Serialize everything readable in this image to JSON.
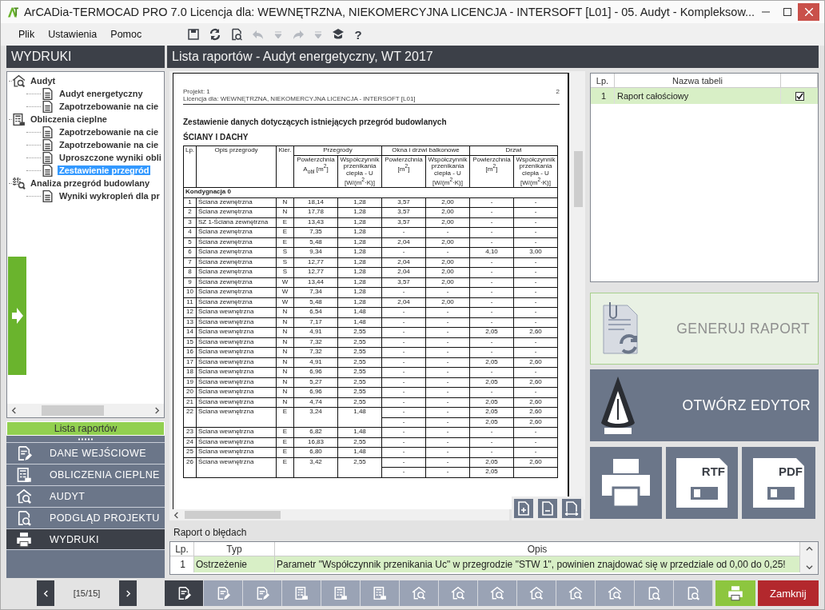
{
  "window": {
    "title": "ArCADia-TERMOCAD PRO 7.0 Licencja dla: WEWNĘTRZNA, NIEKOMERCYJNA LICENCJA - INTERSOFT [L01] - 05. Audyt - Kompleksow..."
  },
  "menu": [
    {
      "label": "Plik"
    },
    {
      "label": "Ustawienia"
    },
    {
      "label": "Pomoc"
    }
  ],
  "toolbar": [
    {
      "kind": "save",
      "disabled": false
    },
    {
      "kind": "refresh",
      "disabled": false
    },
    {
      "kind": "preview",
      "disabled": false
    },
    {
      "kind": "undo",
      "disabled": true
    },
    {
      "kind": "dropdown",
      "disabled": true
    },
    {
      "kind": "redo",
      "disabled": true
    },
    {
      "kind": "dropdown",
      "disabled": true
    },
    {
      "kind": "layers",
      "disabled": false
    },
    {
      "kind": "help",
      "label": "?",
      "disabled": false
    }
  ],
  "sidebar": {
    "title": "WYDRUKI",
    "tree": [
      {
        "label": "Audyt",
        "kind": "audit",
        "selected": false,
        "children": [
          {
            "label": "Audyt energetyczny",
            "kind": "doc",
            "selected": false
          },
          {
            "label": "Zapotrzebowanie na cie",
            "kind": "doc",
            "selected": false
          }
        ]
      },
      {
        "label": "Obliczenia cieplne",
        "kind": "calc",
        "selected": false,
        "children": [
          {
            "label": "Zapotrzebowanie na cie",
            "kind": "doc",
            "selected": false
          },
          {
            "label": "Zapotrzebowanie na cie",
            "kind": "doc",
            "selected": false
          },
          {
            "label": "Uproszczone wyniki obli",
            "kind": "doc",
            "selected": false
          },
          {
            "label": "Zestawienie przegród",
            "kind": "doc",
            "selected": true
          }
        ]
      },
      {
        "label": "Analiza przegród budowlany",
        "kind": "analysis",
        "selected": false,
        "children": [
          {
            "label": "Wyniki wykropleń dla pr",
            "kind": "doc",
            "selected": false
          }
        ]
      }
    ],
    "panel_tab": "Lista raportów",
    "nav": [
      {
        "label": "DANE WEJŚCIOWE",
        "kind": "input",
        "selected": false
      },
      {
        "label": "OBLICZENIA CIEPLNE",
        "kind": "calc",
        "selected": false
      },
      {
        "label": "AUDYT",
        "kind": "audit",
        "selected": false
      },
      {
        "label": "PODGLĄD PROJEKTU",
        "kind": "preview",
        "selected": false
      },
      {
        "label": "WYDRUKI",
        "kind": "print",
        "selected": true
      }
    ],
    "pager": "[15/15]"
  },
  "main": {
    "title": "Lista raportów - Audyt energetyczny, WT 2017",
    "document": {
      "project": "Projekt: 1",
      "license": "Licencja dla: WEWNĘTRZNA, NIEKOMERCYJNA LICENCJA - INTERSOFT [L01]",
      "page": "2",
      "title": "Zestawienie danych dotyczących istniejących przegród budowlanych",
      "subtitle": "ŚCIANY I DACHY",
      "columns": [
        "Lp.",
        "Opis przegrody",
        "Kier."
      ],
      "groups": [
        "Przegrody",
        "Okna i drzwi balkonowe",
        "Drzwi"
      ],
      "subcolumns": [
        "Powierzchnia A$_{obl}$ [m$^{2}$]",
        "Współczynnik przenikania ciepła - U [W/(m$^{2}$·K)]",
        "Powierzchnia [m$^{2}$]",
        "Współczynnik przenikania ciepła - U [W/(m$^{2}$·K)]",
        "Powierzchnia [m$^{2}$]",
        "Współczynnik przenikania ciepła - U [W/(m$^{2}$·K)]"
      ],
      "section": "Kondygnacja 0",
      "rows": [
        {
          "cells": [
            "1",
            "Ściana zewnętrzna",
            "N",
            "18,14",
            "1,28",
            "3,57",
            "2,00",
            "-",
            "-"
          ]
        },
        {
          "cells": [
            "2",
            "Ściana zewnętrzna",
            "N",
            "17,78",
            "1,28",
            "3,57",
            "2,00",
            "-",
            "-"
          ]
        },
        {
          "cells": [
            "3",
            "SZ 1-Ściana zewnętrzna",
            "E",
            "13,43",
            "1,28",
            "3,57",
            "2,00",
            "-",
            "-"
          ]
        },
        {
          "cells": [
            "4",
            "Ściana zewnętrzna",
            "E",
            "7,35",
            "1,28",
            "-",
            "-",
            "-",
            "-"
          ]
        },
        {
          "cells": [
            "5",
            "Ściana zewnętrzna",
            "E",
            "5,48",
            "1,28",
            "2,04",
            "2,00",
            "-",
            "-"
          ]
        },
        {
          "cells": [
            "6",
            "Ściana zewnętrzna",
            "S",
            "9,34",
            "1,28",
            "-",
            "-",
            "4,10",
            "3,00"
          ]
        },
        {
          "cells": [
            "7",
            "Ściana zewnętrzna",
            "S",
            "12,77",
            "1,28",
            "2,04",
            "2,00",
            "-",
            "-"
          ]
        },
        {
          "cells": [
            "8",
            "Ściana zewnętrzna",
            "S",
            "12,77",
            "1,28",
            "2,04",
            "2,00",
            "-",
            "-"
          ]
        },
        {
          "cells": [
            "9",
            "Ściana zewnętrzna",
            "W",
            "13,44",
            "1,28",
            "3,57",
            "2,00",
            "-",
            "-"
          ]
        },
        {
          "cells": [
            "10",
            "Ściana zewnętrzna",
            "W",
            "7,34",
            "1,28",
            "-",
            "-",
            "-",
            "-"
          ]
        },
        {
          "cells": [
            "11",
            "Ściana zewnętrzna",
            "W",
            "5,48",
            "1,28",
            "2,04",
            "2,00",
            "-",
            "-"
          ]
        },
        {
          "cells": [
            "12",
            "Ściana wewnętrzna",
            "N",
            "6,54",
            "1,48",
            "-",
            "-",
            "-",
            "-"
          ]
        },
        {
          "cells": [
            "13",
            "Ściana wewnętrzna",
            "N",
            "7,17",
            "1,48",
            "-",
            "-",
            "-",
            "-"
          ]
        },
        {
          "cells": [
            "14",
            "Ściana wewnętrzna",
            "N",
            "4,91",
            "2,55",
            "-",
            "-",
            "2,05",
            "2,60"
          ]
        },
        {
          "cells": [
            "15",
            "Ściana wewnętrzna",
            "N",
            "7,32",
            "2,55",
            "-",
            "-",
            "-",
            "-"
          ]
        },
        {
          "cells": [
            "16",
            "Ściana wewnętrzna",
            "N",
            "7,32",
            "2,55",
            "-",
            "-",
            "-",
            "-"
          ]
        },
        {
          "cells": [
            "17",
            "Ściana wewnętrzna",
            "N",
            "4,91",
            "2,55",
            "-",
            "-",
            "2,05",
            "2,60"
          ]
        },
        {
          "cells": [
            "18",
            "Ściana wewnętrzna",
            "N",
            "6,96",
            "2,55",
            "-",
            "-",
            "-",
            "-"
          ]
        },
        {
          "cells": [
            "19",
            "Ściana wewnętrzna",
            "N",
            "5,27",
            "2,55",
            "-",
            "-",
            "2,05",
            "2,60"
          ]
        },
        {
          "cells": [
            "20",
            "Ściana wewnętrzna",
            "N",
            "6,96",
            "2,55",
            "-",
            "-",
            "-",
            "-"
          ]
        },
        {
          "cells": [
            "21",
            "Ściana wewnętrzna",
            "N",
            "4,74",
            "2,55",
            "-",
            "-",
            "2,05",
            "2,60"
          ]
        },
        {
          "cells": [
            "22",
            "Ściana wewnętrzna",
            "E",
            "3,24",
            "1,48",
            "-",
            "-",
            "2,05",
            "2,60"
          ],
          "sub_rows": [
            [
              "-",
              "-",
              "2,05",
              "2,60"
            ]
          ]
        },
        {
          "cells": [
            "23",
            "Ściana wewnętrzna",
            "E",
            "6,82",
            "1,48",
            "-",
            "-",
            "-",
            "-"
          ]
        },
        {
          "cells": [
            "24",
            "Ściana wewnętrzna",
            "E",
            "16,83",
            "2,55",
            "-",
            "-",
            "-",
            "-"
          ]
        },
        {
          "cells": [
            "25",
            "Ściana wewnętrzna",
            "E",
            "6,80",
            "1,48",
            "-",
            "-",
            "-",
            "-"
          ]
        },
        {
          "cells": [
            "26",
            "Ściana wewnętrzna",
            "E",
            "3,42",
            "2,55",
            "-",
            "-",
            "2,05",
            "2,60"
          ],
          "sub_rows": [
            [
              "-",
              "-",
              "2,05"
            ]
          ]
        }
      ]
    },
    "report_table": {
      "columns": [
        "Lp.",
        "Nazwa tabeli"
      ],
      "rows": [
        {
          "lp": "1",
          "name": "Raport całościowy",
          "selected": true,
          "checked": true
        }
      ]
    },
    "actions": [
      {
        "kind": "generate",
        "label": "GENERUJ RAPORT",
        "disabled": true
      },
      {
        "kind": "editor",
        "label": "OTWÓRZ EDYTOR",
        "disabled": false
      }
    ],
    "exports": [
      {
        "kind": "print"
      },
      {
        "kind": "floppy",
        "label": "RTF"
      },
      {
        "kind": "floppy",
        "label": "PDF"
      }
    ],
    "errors": {
      "title": "Raport o błędach",
      "columns": [
        "Lp.",
        "Typ",
        "Opis"
      ],
      "rows": [
        {
          "lp": "1",
          "type": "Ostrzeżenie",
          "text": "Parametr \"Współczynnik przenikania Uc\" w przegrodzie \"STW 1\", powinien znajdować się w przedziale od 0,00 do 0,25!",
          "selected": true
        }
      ]
    }
  },
  "bottom_toolbar": [
    {
      "kind": "input",
      "selected": true
    },
    {
      "kind": "input",
      "selected": false
    },
    {
      "kind": "input",
      "selected": false
    },
    {
      "kind": "calc",
      "selected": false
    },
    {
      "kind": "calc",
      "selected": false
    },
    {
      "kind": "calc",
      "selected": false
    },
    {
      "kind": "audit",
      "selected": false
    },
    {
      "kind": "audit",
      "selected": false
    },
    {
      "kind": "audit",
      "selected": false
    },
    {
      "kind": "audit",
      "selected": false
    },
    {
      "kind": "audit",
      "selected": false
    },
    {
      "kind": "audit",
      "selected": false
    },
    {
      "kind": "preview",
      "selected": false
    },
    {
      "kind": "preview",
      "selected": false
    }
  ],
  "print_button": {
    "kind": "print"
  },
  "close_button": {
    "label": "Zamknij"
  }
}
